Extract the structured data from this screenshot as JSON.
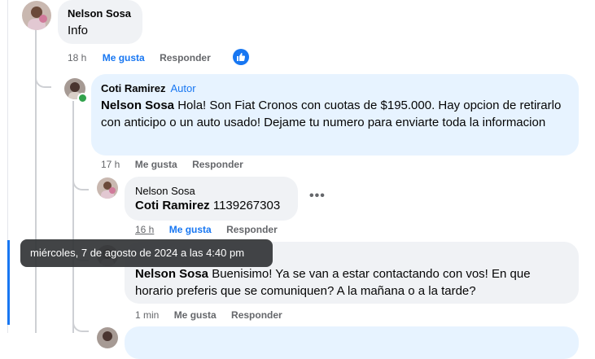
{
  "colors": {
    "link_blue": "#1877f2",
    "bubble_gray": "#f0f2f5",
    "bubble_highlight": "#e7f3ff",
    "meta_gray": "#65676b",
    "online_green": "#31a24c"
  },
  "comments": [
    {
      "author": "Nelson Sosa",
      "text": "Info",
      "time": "18 h",
      "like_label": "Me gusta",
      "reply_label": "Responder",
      "reaction_icon": "like-icon"
    },
    {
      "author": "Coti Ramirez",
      "badge": "Autor",
      "mention": "Nelson Sosa",
      "text": "Hola! Son Fiat Cronos con cuotas de $195.000. Hay opcion de retirarlo con anticipo o un auto usado! Dejame tu numero para enviarte toda la informacion",
      "time": "17 h",
      "like_label": "Me gusta",
      "reply_label": "Responder"
    },
    {
      "author": "Nelson Sosa",
      "mention": "Coti Ramirez",
      "text": "1139267303",
      "time": "16 h",
      "like_label": "Me gusta",
      "reply_label": "Responder",
      "more_icon": "more-options-icon"
    },
    {
      "mention": "Nelson Sosa",
      "text": "Buenisimo! Ya se van a estar contactando con vos! En que horario preferis que se comuniquen? A la mañana o a la tarde?",
      "time": "1 min",
      "like_label": "Me gusta",
      "reply_label": "Responder"
    }
  ],
  "tooltip": {
    "text": "miércoles, 7 de agosto de 2024 a las 4:40 pm"
  }
}
